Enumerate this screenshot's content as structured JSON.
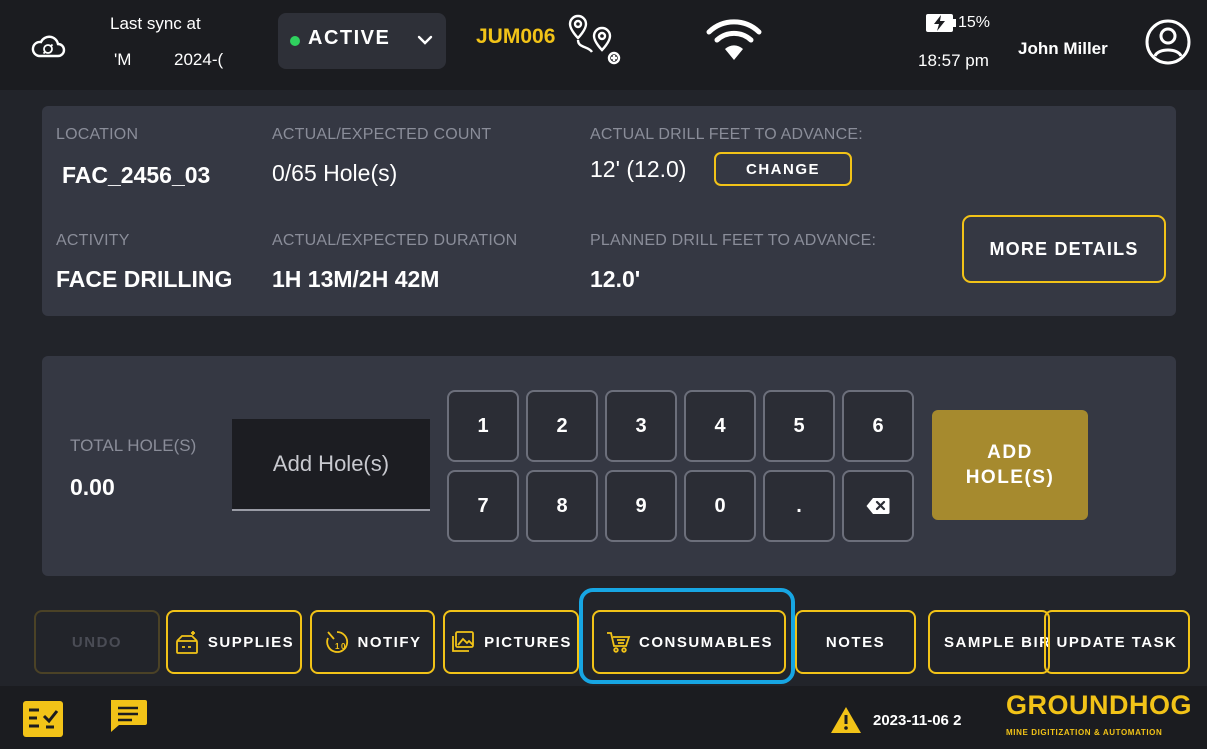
{
  "header": {
    "sync_title": "Last sync at",
    "sync_time": "'M",
    "sync_date": "2024-(",
    "status": "ACTIVE",
    "equipment_id": "JUM006",
    "battery": "15%",
    "clock": "18:57 pm",
    "user_name": "John Miller"
  },
  "info": {
    "location_label": "LOCATION",
    "location_value": "FAC_2456_03",
    "count_label": "ACTUAL/EXPECTED COUNT",
    "count_value": "0/65 Hole(s)",
    "drill_actual_label": "ACTUAL DRILL FEET TO ADVANCE:",
    "drill_actual_value": "12' (12.0)",
    "change_label": "CHANGE",
    "activity_label": "ACTIVITY",
    "activity_value": "FACE DRILLING",
    "duration_label": "ACTUAL/EXPECTED DURATION",
    "duration_value": "1H 13M/2H 42M",
    "drill_planned_label": "PLANNED DRILL FEET TO ADVANCE:",
    "drill_planned_value": "12.0'",
    "more_details_label": "MORE DETAILS"
  },
  "entry": {
    "total_label": "TOTAL HOLE(S)",
    "total_value": "0.00",
    "input_placeholder": "Add Hole(s)",
    "keys_row1": [
      "1",
      "2",
      "3",
      "4",
      "5",
      "6"
    ],
    "keys_row2": [
      "7",
      "8",
      "9",
      "0",
      "."
    ],
    "add_label_line1": "ADD",
    "add_label_line2": "HOLE(S)"
  },
  "actions": {
    "undo": "UNDO",
    "supplies": "SUPPLIES",
    "notify": "NOTIFY",
    "pictures": "PICTURES",
    "consumables": "CONSUMABLES",
    "notes": "NOTES",
    "sample": "SAMPLE BIRD",
    "update_task": "UPDATE TASK"
  },
  "footer": {
    "date": "2023-11-06 2",
    "brand": "GROUNDHOG",
    "brand_sub": "MINE DIGITIZATION & AUTOMATION"
  },
  "colors": {
    "accent": "#f2c318",
    "active": "#2fd15e",
    "highlight": "#17a6e3",
    "add_button": "#a68a2e"
  },
  "icons": [
    "cloud-sync-icon",
    "chevron-down-icon",
    "route-icon",
    "wifi-icon",
    "battery-charging-icon",
    "user-icon",
    "backspace-icon",
    "supplies-icon",
    "timer-icon",
    "pictures-icon",
    "cart-icon",
    "plus-icon",
    "task-list-icon",
    "chat-icon",
    "warning-icon"
  ]
}
